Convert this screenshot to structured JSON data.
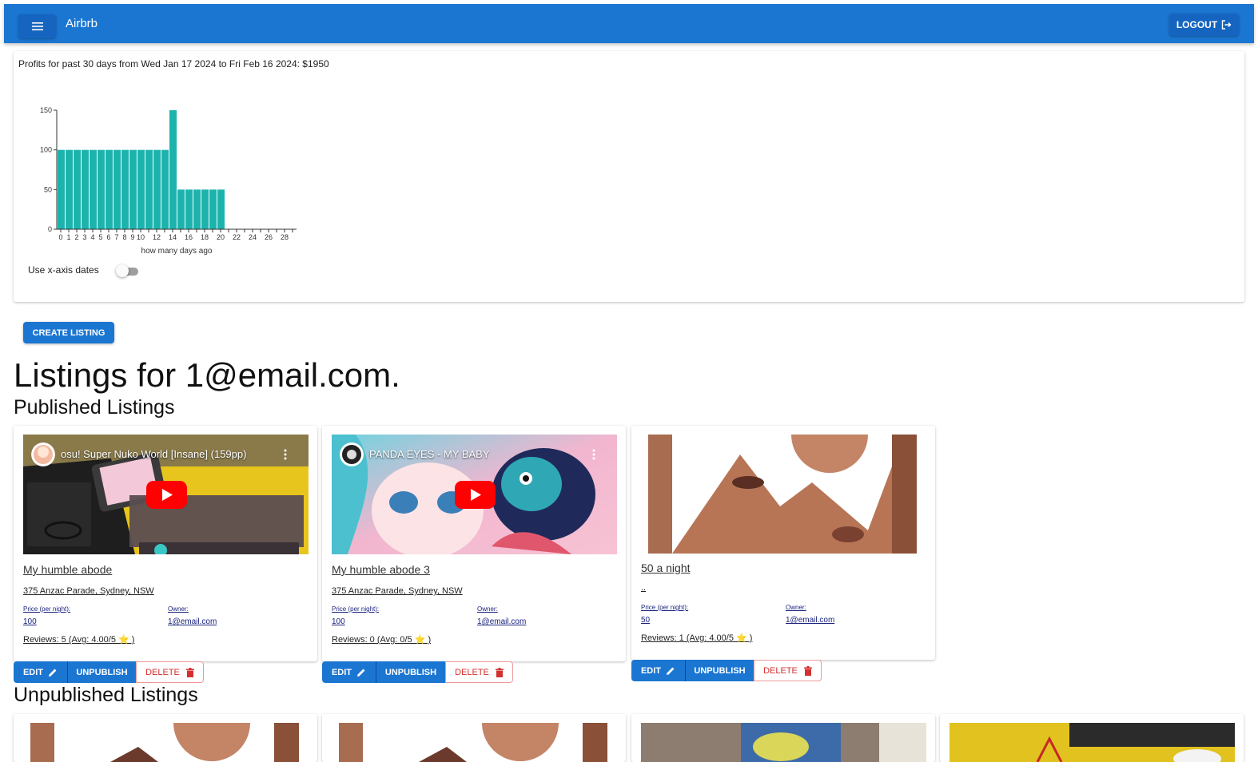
{
  "app": {
    "title": "Airbrb",
    "logout_label": "LOGOUT"
  },
  "profits": {
    "summary": "Profits for past 30 days from Wed Jan 17 2024 to Fri Feb 16 2024: $1950",
    "toggle_label": "Use x-axis dates",
    "toggle_on": false
  },
  "chart_data": {
    "type": "bar",
    "xlabel": "how many days ago",
    "ylabel": "",
    "ylim": [
      0,
      150
    ],
    "yticks": [
      0,
      50,
      100,
      150
    ],
    "xticks": [
      0,
      1,
      2,
      3,
      4,
      5,
      6,
      7,
      8,
      9,
      10,
      12,
      14,
      16,
      18,
      20,
      22,
      24,
      26,
      28
    ],
    "x": [
      0,
      1,
      2,
      3,
      4,
      5,
      6,
      7,
      8,
      9,
      10,
      11,
      12,
      13,
      14,
      15,
      16,
      17,
      18,
      19,
      20,
      21,
      22,
      23,
      24,
      25,
      26,
      27,
      28,
      29
    ],
    "values": [
      100,
      100,
      100,
      100,
      100,
      100,
      100,
      100,
      100,
      100,
      100,
      100,
      100,
      100,
      150,
      50,
      50,
      50,
      50,
      50,
      50,
      0,
      0,
      0,
      0,
      0,
      0,
      0,
      0,
      0
    ],
    "color": "#1cb3ad"
  },
  "actions": {
    "create_label": "CREATE LISTING"
  },
  "headings": {
    "listings_for": "Listings for 1@email.com.",
    "published": "Published Listings",
    "unpublished": "Unpublished Listings"
  },
  "labels": {
    "price": "Price (per night):",
    "owner": "Owner:",
    "edit": "EDIT",
    "unpublish": "UNPUBLISH",
    "delete": "DELETE"
  },
  "published": [
    {
      "title": "My humble abode",
      "address": "375 Anzac Parade, Sydney, NSW",
      "price": "100",
      "owner": "1@email.com",
      "reviews": "Reviews: 5 (Avg: 4.00/5 ⭐ )",
      "thumb": "video",
      "video_title": "osu! Super Nuko World [Insane] (159pp)"
    },
    {
      "title": "My humble abode 3",
      "address": "375 Anzac Parade, Sydney, NSW",
      "price": "100",
      "owner": "1@email.com",
      "reviews": "Reviews: 0 (Avg: 0/5 ⭐ )",
      "thumb": "video",
      "video_title": "PANDA EYES - MY BABY"
    },
    {
      "title": "50 a night",
      "address": "..",
      "price": "50",
      "owner": "1@email.com",
      "reviews": "Reviews: 1 (Avg: 4.00/5 ⭐ )",
      "thumb": "image"
    }
  ],
  "colors": {
    "appbar": "#1b76d2",
    "primary_button": "#1b76d2",
    "delete": "#d32f2f",
    "bars": "#1cb3ad"
  }
}
